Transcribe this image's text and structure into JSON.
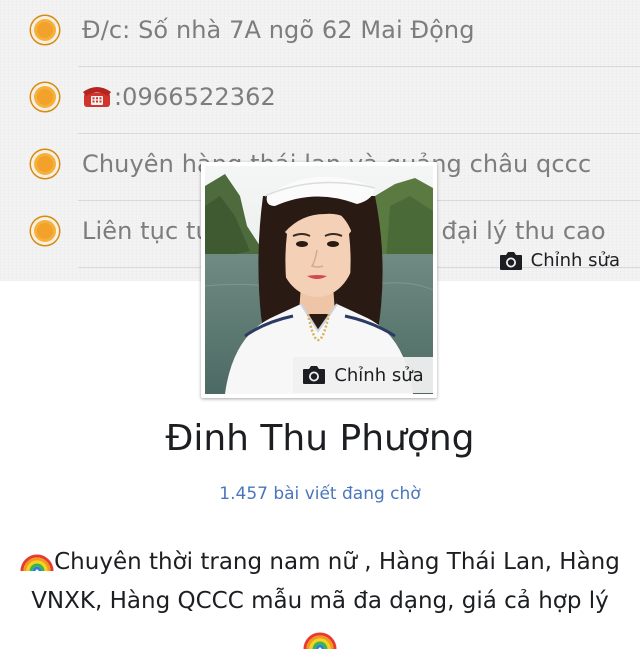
{
  "cover": {
    "lines": [
      {
        "text": "Đ/c: Số nhà 7A ngõ 62 Mai Động",
        "icon": "orange-dot-icon"
      },
      {
        "text": ":0966522362",
        "icon": "telephone-icon"
      },
      {
        "text": "Chuyên hàng thái lan và quảng châu qccc",
        "icon": "orange-dot-icon"
      },
      {
        "text": "Liên tục tuyển cộng tác viên, đại lý thu cao",
        "icon": "orange-dot-icon"
      }
    ],
    "edit_label": "Chỉnh sửa"
  },
  "avatar": {
    "edit_label": "Chỉnh sửa"
  },
  "profile": {
    "name": "Đinh Thu Phượng",
    "pending_posts": "1.457 bài viết đang chờ",
    "bio_line1": "Chuyên thời trang nam nữ , Hàng Thái Lan, Hàng",
    "bio_line2": "VNXK, Hàng QCCC mẫu mã đa dạng, giá cả hợp lý"
  },
  "colors": {
    "accent_orange": "#f5b13d",
    "link_blue": "#4a76bd"
  }
}
